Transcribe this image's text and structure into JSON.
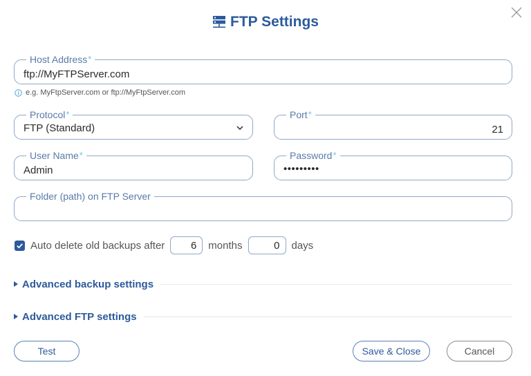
{
  "dialog": {
    "title": "FTP Settings"
  },
  "host": {
    "label": "Host Address",
    "required_mark": "*",
    "value": "ftp://MyFTPServer.com",
    "hint": "e.g. MyFtpServer.com or ftp://MyFtpServer.com"
  },
  "protocol": {
    "label": "Protocol",
    "required_mark": "*",
    "value": "FTP (Standard)"
  },
  "port": {
    "label": "Port",
    "required_mark": "*",
    "value": "21"
  },
  "username": {
    "label": "User Name",
    "required_mark": "*",
    "value": "Admin"
  },
  "password": {
    "label": "Password",
    "required_mark": "*",
    "value": "•••••••••"
  },
  "folder": {
    "label": "Folder (path) on FTP Server",
    "value": ""
  },
  "auto_delete": {
    "checked": true,
    "label": "Auto delete old backups after",
    "months_value": "6",
    "months_label": "months",
    "days_value": "0",
    "days_label": "days"
  },
  "sections": {
    "advanced_backup": "Advanced backup settings",
    "advanced_ftp": "Advanced FTP settings"
  },
  "buttons": {
    "test": "Test",
    "save_close": "Save & Close",
    "cancel": "Cancel"
  },
  "colors": {
    "accent": "#2c5a9c",
    "border": "#8fa8c8",
    "required": "#6ec3ea"
  }
}
